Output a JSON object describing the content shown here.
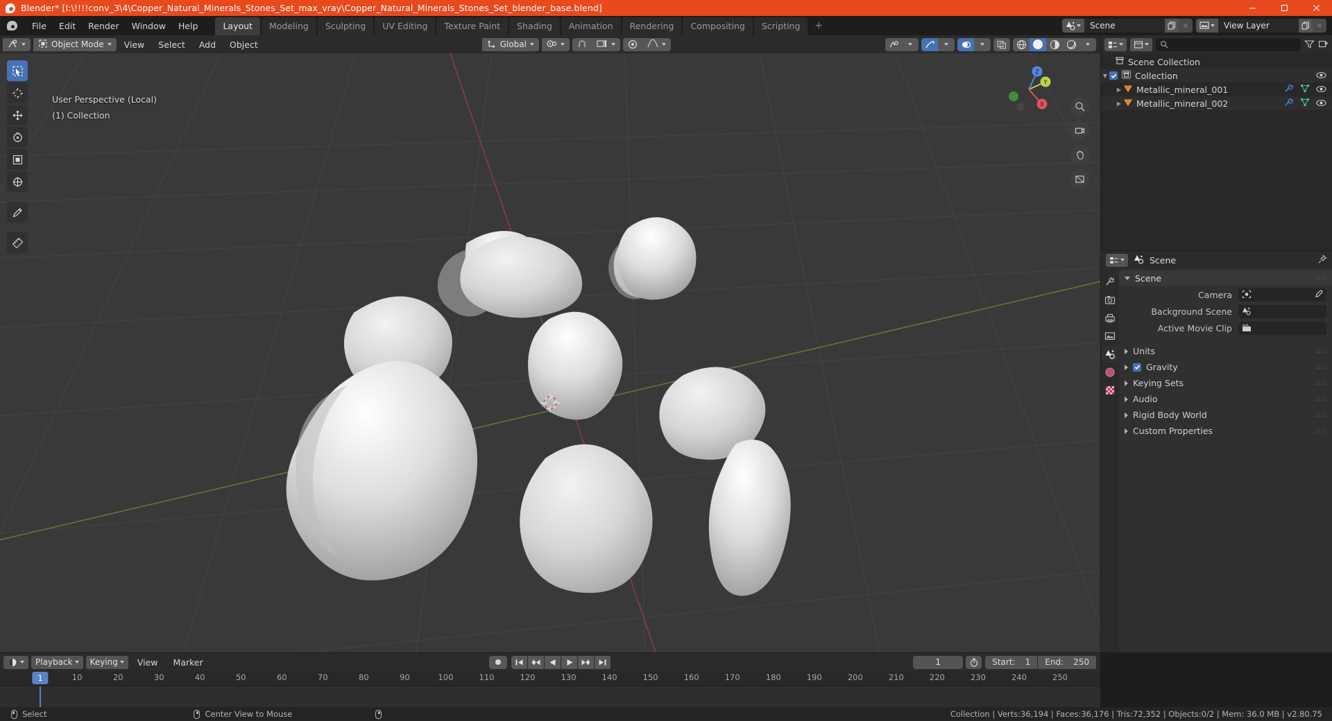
{
  "window": {
    "title": "Blender* [I:\\!!!!conv_3\\4\\Copper_Natural_Minerals_Stones_Set_max_vray\\Copper_Natural_Minerals_Stones_Set_blender_base.blend]",
    "app_icon": "blender-logo-icon",
    "minimize": "minimize-icon",
    "maximize": "maximize-icon",
    "close": "close-icon"
  },
  "topbar": {
    "menus": [
      "File",
      "Edit",
      "Render",
      "Window",
      "Help"
    ],
    "workspaces": [
      {
        "label": "Layout",
        "active": true
      },
      {
        "label": "Modeling",
        "active": false
      },
      {
        "label": "Sculpting",
        "active": false
      },
      {
        "label": "UV Editing",
        "active": false
      },
      {
        "label": "Texture Paint",
        "active": false
      },
      {
        "label": "Shading",
        "active": false
      },
      {
        "label": "Animation",
        "active": false
      },
      {
        "label": "Rendering",
        "active": false
      },
      {
        "label": "Compositing",
        "active": false
      },
      {
        "label": "Scripting",
        "active": false
      }
    ],
    "add_workspace": "+",
    "scene": {
      "name": "Scene",
      "icon": "scene-icon",
      "new_icon": "duplicate-icon",
      "unlink_icon": "x-icon"
    },
    "view_layer": {
      "name": "View Layer",
      "icon": "view-layer-icon",
      "new_icon": "duplicate-icon",
      "unlink_icon": "x-icon"
    }
  },
  "viewport": {
    "editor_type_icon": "editor-type-3dview-icon",
    "mode": "Object Mode",
    "mode_icon": "object-mode-icon",
    "menus": [
      "View",
      "Select",
      "Add",
      "Object"
    ],
    "transform_orientation": "Global",
    "transform_icon": "orientation-axes-icon",
    "pivot_icon": "pivot-point-icon",
    "snap_icon": "magnet-icon",
    "snap_target_icon": "snap-increment-icon",
    "proportional_icon": "proportional-edit-icon",
    "falloff_icon": "falloff-curve-icon",
    "overlay_line1": "User Perspective (Local)",
    "overlay_line2": "(1) Collection",
    "tools": [
      {
        "name": "select-box-tool",
        "active": true
      },
      {
        "name": "cursor-tool",
        "active": false
      },
      {
        "name": "move-tool",
        "active": false
      },
      {
        "name": "rotate-tool",
        "active": false
      },
      {
        "name": "scale-tool",
        "active": false
      },
      {
        "name": "transform-tool",
        "active": false
      },
      {
        "name": "annotate-tool",
        "active": false
      },
      {
        "name": "measure-tool",
        "active": false
      }
    ],
    "gizmo_axes": [
      {
        "label": "X",
        "color": "#e0565b"
      },
      {
        "label": "Y",
        "color": "#b7d44b"
      },
      {
        "label": "Z",
        "color": "#5786e0"
      }
    ],
    "nav_buttons": [
      "zoom-icon",
      "camera-view-icon",
      "hand-pan-icon",
      "perspective-toggle-icon"
    ],
    "header_right": {
      "visibility_icon": "object-visibility-icon",
      "gizmo_icon": "gizmo-icon",
      "overlays_icon": "overlays-icon",
      "xray_icon": "xray-toggle-icon",
      "shading_modes": [
        "wireframe-shading",
        "solid-shading",
        "material-shading",
        "rendered-shading"
      ],
      "shading_active": 1
    }
  },
  "outliner": {
    "display_mode_icon": "outliner-display-mode-icon",
    "filter_icon": "filter-icon",
    "search_icon": "search-icon",
    "search_placeholder": "",
    "rows": [
      {
        "name": "Scene Collection",
        "icon": "scene-collection-icon",
        "depth": 0,
        "has_check": false,
        "has_eye": false,
        "has_tri": false,
        "extra_icons": []
      },
      {
        "name": "Collection",
        "icon": "collection-icon",
        "depth": 1,
        "has_check": true,
        "has_eye": true,
        "has_tri": true,
        "extra_icons": []
      },
      {
        "name": "Metallic_mineral_001",
        "icon": "mesh-object-icon",
        "depth": 2,
        "has_check": false,
        "has_eye": true,
        "has_tri": true,
        "extra_icons": [
          "modifier-wrench-icon",
          "mesh-data-icon"
        ]
      },
      {
        "name": "Metallic_mineral_002",
        "icon": "mesh-object-icon",
        "depth": 2,
        "has_check": false,
        "has_eye": true,
        "has_tri": true,
        "extra_icons": [
          "modifier-wrench-icon",
          "mesh-data-icon"
        ]
      }
    ]
  },
  "properties": {
    "editor_icon": "properties-editor-icon",
    "breadcrumb_icon": "scene-properties-icon",
    "breadcrumb": "Scene",
    "pin_icon": "pin-icon",
    "tabs": [
      {
        "name": "tool-tab",
        "icon": "tool-wrench-screwdriver-icon",
        "active": false
      },
      {
        "name": "render-tab",
        "icon": "camera-back-icon",
        "active": false
      },
      {
        "name": "output-tab",
        "icon": "printer-icon",
        "active": false
      },
      {
        "name": "view-layer-tab",
        "icon": "images-icon",
        "active": false
      },
      {
        "name": "scene-tab",
        "icon": "scene-cone-icon",
        "active": true
      },
      {
        "name": "world-tab",
        "icon": "world-globe-icon",
        "active": false
      },
      {
        "name": "texture-tab",
        "icon": "checker-texture-icon",
        "active": false
      }
    ],
    "panel_title": "Scene",
    "fields": [
      {
        "label": "Camera",
        "icon": "camera-object-icon",
        "value": "",
        "eyedropper": true
      },
      {
        "label": "Background Scene",
        "icon": "scene-icon",
        "value": "",
        "eyedropper": false
      },
      {
        "label": "Active Movie Clip",
        "icon": "movie-clip-icon",
        "value": "",
        "eyedropper": false
      }
    ],
    "sections": [
      {
        "label": "Units",
        "checkbox": null
      },
      {
        "label": "Gravity",
        "checkbox": true
      },
      {
        "label": "Keying Sets",
        "checkbox": null
      },
      {
        "label": "Audio",
        "checkbox": null
      },
      {
        "label": "Rigid Body World",
        "checkbox": null
      },
      {
        "label": "Custom Properties",
        "checkbox": null
      }
    ]
  },
  "timeline": {
    "editor_icon": "timeline-editor-icon",
    "menus_dropdown": [
      "Playback",
      "Keying"
    ],
    "menus": [
      "View",
      "Marker"
    ],
    "record_icon": "record-keyframes-icon",
    "playback_buttons": [
      "jump-to-start-icon",
      "jump-prev-keyframe-icon",
      "play-reverse-icon",
      "play-icon",
      "jump-next-keyframe-icon",
      "jump-to-end-icon"
    ],
    "current_frame": "1",
    "use_preview_icon": "stopwatch-icon",
    "start_label": "Start:",
    "start_value": "1",
    "end_label": "End:",
    "end_value": "250",
    "ruler_ticks": [
      10,
      20,
      30,
      40,
      50,
      60,
      70,
      80,
      90,
      100,
      110,
      120,
      130,
      140,
      150,
      160,
      170,
      180,
      190,
      200,
      210,
      220,
      230,
      240,
      250
    ],
    "playhead_frame": "1"
  },
  "statusbar": {
    "left_items": [
      {
        "mouse": "left-mouse-icon",
        "label": "Select"
      },
      {
        "mouse": "middle-mouse-icon",
        "label": "Center View to Mouse"
      },
      {
        "mouse": "right-mouse-icon",
        "label": ""
      }
    ],
    "scene_stats": "Collection | Verts:36,194 | Faces:36,176 | Tris:72,352 | Objects:0/2 | Mem: 36.0 MB | v2.80.75"
  },
  "colors": {
    "title_bar": "#e8491d",
    "accent_blue": "#4772b3",
    "axis_x": "#e0565b",
    "axis_y": "#b7d44b",
    "axis_z": "#5786e0",
    "viewport_bg": "#393939"
  }
}
